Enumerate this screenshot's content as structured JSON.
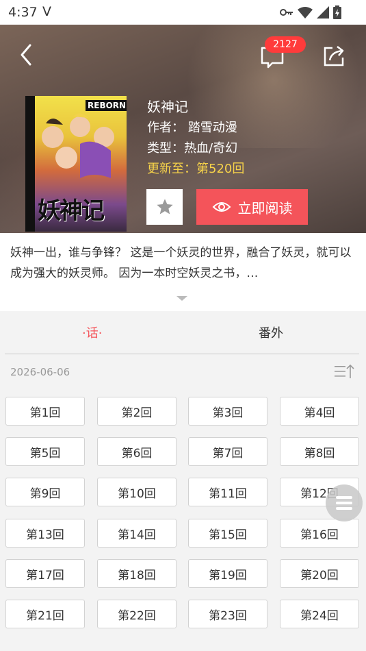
{
  "status_bar": {
    "time": "4:37",
    "carrier_letter": "V"
  },
  "header": {
    "comment_count": "2127",
    "cover_text": "妖神记",
    "cover_tag": "REBORN",
    "title": "妖神记",
    "author": "作者： 踏雪动漫",
    "genre": "类型：热血/奇幻",
    "update": "更新至：第520回",
    "read_button_label": "立即阅读"
  },
  "description": {
    "text": "妖神一出，谁与争锋？ 这是一个妖灵的世界，融合了妖灵，就可以成为强大的妖灵师。 因为一本时空妖灵之书，…"
  },
  "tabs": [
    {
      "label": "·话·",
      "active": true
    },
    {
      "label": "番外",
      "active": false
    }
  ],
  "chapter_list": {
    "date": "2026-06-06",
    "episodes": [
      "第1回",
      "第2回",
      "第3回",
      "第4回",
      "第5回",
      "第6回",
      "第7回",
      "第8回",
      "第9回",
      "第10回",
      "第11回",
      "第12回",
      "第13回",
      "第14回",
      "第15回",
      "第16回",
      "第17回",
      "第18回",
      "第19回",
      "第20回",
      "第21回",
      "第22回",
      "第23回",
      "第24回"
    ]
  },
  "colors": {
    "accent": "#f4545a",
    "update": "#f6d24a",
    "badge": "#ff3b3b"
  },
  "icons": [
    "back-icon",
    "comment-icon",
    "share-icon",
    "star-icon",
    "eye-icon",
    "sort-icon",
    "menu-icon",
    "key-icon",
    "wifi-icon",
    "signal-icon",
    "battery-icon"
  ]
}
